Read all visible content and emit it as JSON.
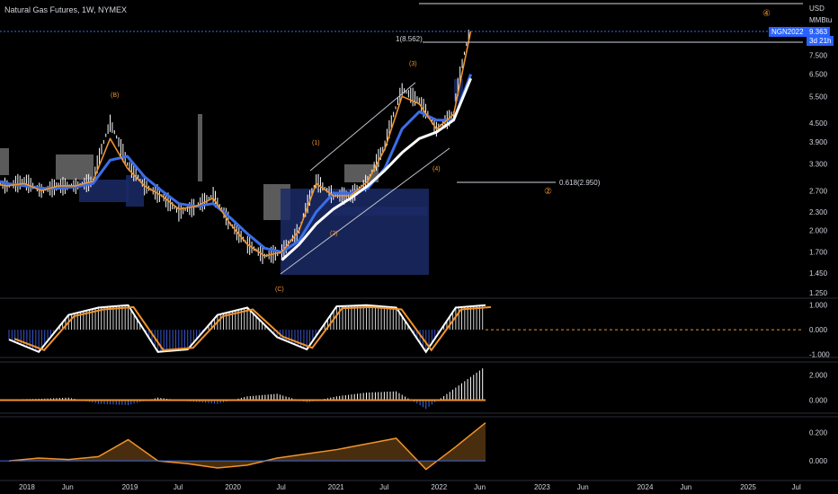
{
  "header": {
    "symbol_line": "Natural Gas Futures, 1W, NYMEX",
    "currency": "USD",
    "unit": "MMBtu"
  },
  "price_badges": {
    "symbol": "NGN2022",
    "last_price": "9.363",
    "countdown": "3d 21h"
  },
  "colors": {
    "background": "#000000",
    "up_candle": "#ffffff",
    "down_candle": "#ffffff",
    "ma_blue": "#3a6ee8",
    "ma_orange": "#f0932b",
    "ma_white": "#ffffff",
    "volume_box_gray": "#7a7a7a",
    "volume_box_blue": "#1b2a66",
    "badge_blue": "#2962ff",
    "grid": "#1b1d24"
  },
  "chart_data": [
    {
      "type": "line",
      "title": "Natural Gas Futures, 1W, NYMEX",
      "ylabel": "USD / MMBtu",
      "log_scale": true,
      "ylim": [
        1.2,
        11.0
      ],
      "y_ticks": [
        "1.250",
        "1.450",
        "1.700",
        "2.000",
        "2.300",
        "2.700",
        "3.300",
        "3.900",
        "4.500",
        "5.500",
        "6.500",
        "7.500",
        "9.363"
      ],
      "x_ticks": [
        "2018",
        "Jun",
        "2019",
        "Jul",
        "2020",
        "Jul",
        "2021",
        "Jul",
        "2022",
        "Jun",
        "2023",
        "Jun",
        "2024",
        "Jun",
        "2025",
        "Jul"
      ],
      "x": [
        "2017-09",
        "2017-11",
        "2018-01",
        "2018-03",
        "2018-05",
        "2018-07",
        "2018-09",
        "2018-11",
        "2019-01",
        "2019-03",
        "2019-05",
        "2019-07",
        "2019-09",
        "2019-11",
        "2020-01",
        "2020-03",
        "2020-05",
        "2020-07",
        "2020-09",
        "2020-11",
        "2021-01",
        "2021-03",
        "2021-05",
        "2021-07",
        "2021-09",
        "2021-11",
        "2022-01",
        "2022-03",
        "2022-05"
      ],
      "series": [
        {
          "name": "",
          "kind": "price",
          "values": [
            2.9,
            2.8,
            2.9,
            2.7,
            2.8,
            2.8,
            2.9,
            4.5,
            3.3,
            2.8,
            2.6,
            2.3,
            2.4,
            2.6,
            2.1,
            1.8,
            1.65,
            1.7,
            2.0,
            2.9,
            2.6,
            2.6,
            2.9,
            3.8,
            5.8,
            5.3,
            4.3,
            4.8,
            9.3
          ]
        },
        {
          "name": "",
          "kind": "ma_blue",
          "values": [
            2.95,
            2.85,
            2.8,
            2.75,
            2.75,
            2.78,
            2.85,
            3.4,
            3.5,
            3.0,
            2.7,
            2.45,
            2.4,
            2.45,
            2.2,
            1.95,
            1.75,
            1.7,
            1.85,
            2.3,
            2.65,
            2.65,
            2.75,
            3.2,
            4.3,
            4.9,
            4.6,
            4.6,
            6.5
          ]
        },
        {
          "name": "",
          "kind": "ma_orange",
          "values": [
            2.85,
            2.8,
            2.85,
            2.7,
            2.8,
            2.8,
            2.9,
            4.0,
            3.2,
            2.8,
            2.6,
            2.35,
            2.4,
            2.55,
            2.1,
            1.8,
            1.65,
            1.7,
            2.0,
            2.85,
            2.6,
            2.6,
            2.9,
            3.7,
            5.5,
            5.2,
            4.3,
            4.8,
            9.0
          ]
        },
        {
          "name": "",
          "kind": "ma_white",
          "values": [
            null,
            null,
            null,
            null,
            null,
            null,
            null,
            null,
            null,
            null,
            null,
            null,
            null,
            null,
            null,
            null,
            null,
            1.6,
            1.8,
            2.1,
            2.35,
            2.55,
            2.8,
            3.15,
            3.6,
            4.0,
            4.2,
            4.6,
            6.3
          ]
        }
      ],
      "annotations": [
        {
          "text": "(B)",
          "at": "2018-11"
        },
        {
          "text": "(C)",
          "at": "2020-06"
        },
        {
          "text": "(1)",
          "at": "2020-11"
        },
        {
          "text": "(2)",
          "at": "2021-01"
        },
        {
          "text": "(3)",
          "at": "2021-10"
        },
        {
          "text": "(4)",
          "at": "2022-01"
        },
        {
          "text": "1(8.562)",
          "value": 8.562
        },
        {
          "text": "0.618(2.950)",
          "value": 2.95
        },
        {
          "text": "②",
          "value": 2.75
        },
        {
          "text": "④",
          "value": 11.5
        }
      ]
    },
    {
      "type": "line",
      "panel": "oscillator",
      "ylim": [
        -1.2,
        1.1
      ],
      "y_ticks": [
        "1.000",
        "0.000",
        "-1.000"
      ],
      "series": [
        {
          "name": "",
          "values": [
            -0.4,
            -0.9,
            0.6,
            0.9,
            1.0,
            -0.9,
            -0.8,
            0.6,
            0.9,
            -0.3,
            -0.8,
            0.95,
            1.0,
            0.9,
            -0.9,
            0.9,
            1.0
          ]
        }
      ]
    },
    {
      "type": "bar",
      "panel": "momentum",
      "ylim": [
        -0.9,
        2.9
      ],
      "y_ticks": [
        "2.000",
        "0.000"
      ],
      "series": [
        {
          "name": "",
          "values": [
            0.05,
            0.1,
            0.2,
            -0.3,
            -0.4,
            0.2,
            -0.1,
            -0.3,
            0.3,
            0.5,
            -0.2,
            0.3,
            0.6,
            0.7,
            -0.7,
            1.0,
            2.7
          ]
        }
      ]
    },
    {
      "type": "area",
      "panel": "trend",
      "ylim": [
        -0.12,
        0.3
      ],
      "y_ticks": [
        "0.200",
        "0.000"
      ],
      "series": [
        {
          "name": "",
          "values": [
            0.0,
            0.02,
            0.01,
            0.03,
            0.15,
            0.0,
            -0.02,
            -0.05,
            -0.03,
            0.02,
            0.05,
            0.08,
            0.12,
            0.16,
            -0.06,
            0.1,
            0.27
          ]
        }
      ]
    }
  ],
  "x_labels": [
    "2018",
    "Jun",
    "2019",
    "Jul",
    "2020",
    "Jul",
    "2021",
    "Jul",
    "2022",
    "Jun",
    "2023",
    "Jun",
    "2024",
    "Jun",
    "2025",
    "Jul"
  ],
  "right_axis": {
    "main": [
      "7.500",
      "6.500",
      "5.500",
      "4.500",
      "3.900",
      "3.300",
      "2.700",
      "2.300",
      "2.000",
      "1.700",
      "1.450",
      "1.250"
    ],
    "osc": [
      "1.000",
      "0.000",
      "-1.000"
    ],
    "mom": [
      "2.000",
      "0.000"
    ],
    "trend": [
      "0.200",
      "0.000"
    ]
  }
}
